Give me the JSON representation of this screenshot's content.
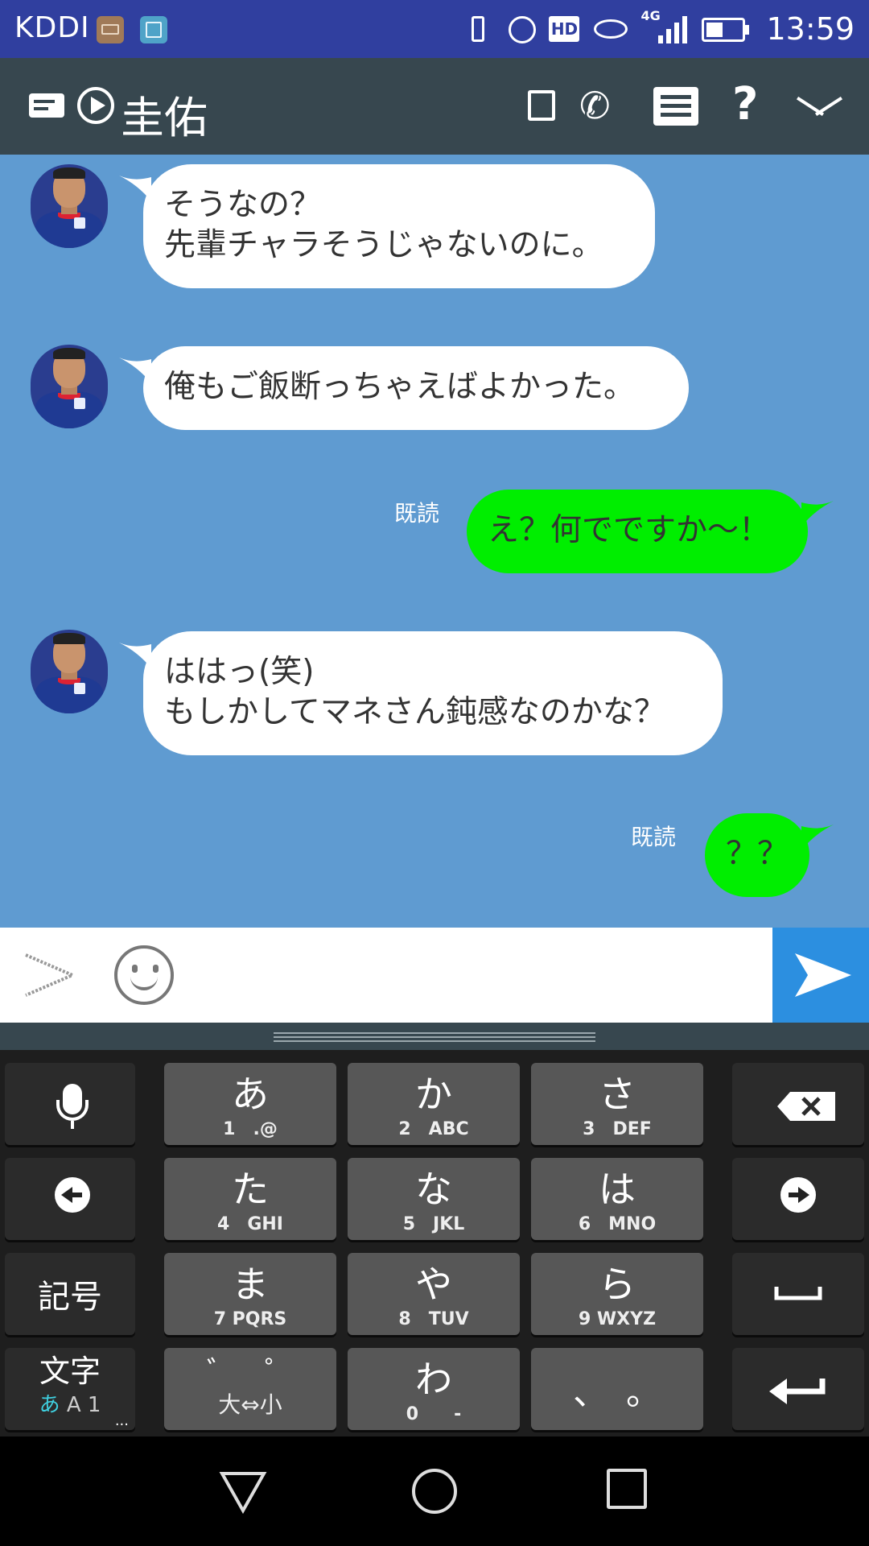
{
  "status_bar": {
    "carrier": "KDDI",
    "network": "4G",
    "time": "13:59",
    "hd_label": "HD",
    "icons": [
      "keyboard-notification-icon",
      "gallery-notification-icon",
      "vibrate-icon",
      "alarm-icon",
      "hd-voice-icon",
      "eye-comfort-icon",
      "signal-icon",
      "battery-icon"
    ]
  },
  "header": {
    "title": "圭佑",
    "icons": [
      "message-icon",
      "play-icon",
      "note-icon",
      "phone-icon",
      "menu-icon",
      "help-icon",
      "collapse-icon"
    ]
  },
  "messages": [
    {
      "side": "in",
      "lines": [
        "そうなの？",
        "先輩チャラそうじゃないのに。"
      ]
    },
    {
      "side": "in",
      "lines": [
        "俺もご飯断っちゃえばよかった。"
      ]
    },
    {
      "side": "out",
      "lines": [
        "え？何でですか～！"
      ],
      "read": "既読"
    },
    {
      "side": "in",
      "lines": [
        "ははっ(笑)",
        "もしかしてマネさん鈍感なのかな？"
      ]
    },
    {
      "side": "out",
      "lines": [
        "？？"
      ],
      "read": "既読"
    }
  ],
  "colors": {
    "chat_background": "#5f9bd1",
    "outgoing_bubble": "#00ee00",
    "incoming_bubble": "#ffffff",
    "header": "#37474f",
    "status_bar": "#303f9f",
    "send_button": "#2c8fe0"
  },
  "input_bar": {
    "icons": [
      "expand-icon",
      "emoji-icon",
      "send-icon"
    ],
    "value": ""
  },
  "keyboard": {
    "keys": {
      "a": {
        "big": "あ",
        "sub": "1　.@"
      },
      "ka": {
        "big": "か",
        "sub": "2　ABC"
      },
      "sa": {
        "big": "さ",
        "sub": "3　DEF"
      },
      "ta": {
        "big": "た",
        "sub": "4　GHI"
      },
      "na": {
        "big": "な",
        "sub": "5　JKL"
      },
      "ha": {
        "big": "は",
        "sub": "6　MNO"
      },
      "ma": {
        "big": "ま",
        "sub": "7 PQRS"
      },
      "ya": {
        "big": "や",
        "sub": "8　TUV"
      },
      "ra": {
        "big": "ら",
        "sub": "9 WXYZ"
      },
      "dakuten": {
        "big": "゛　゜",
        "sub": "大⇔小"
      },
      "wa": {
        "big": "わ",
        "sub": "0　　-"
      },
      "punct": {
        "big": "、　。"
      },
      "symbols": {
        "label": "記号"
      },
      "mode": {
        "label": "文字",
        "sub_hira": "あ",
        "sub_rest": "A 1",
        "more": "..."
      }
    }
  }
}
